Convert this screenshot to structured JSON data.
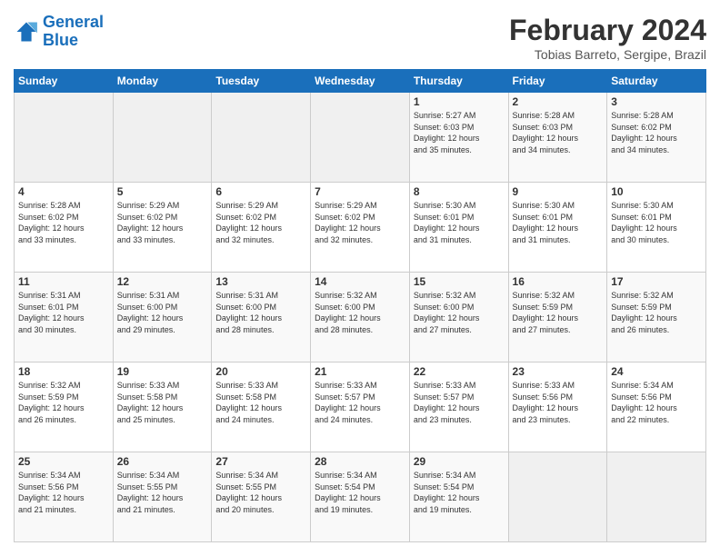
{
  "header": {
    "logo_text_general": "General",
    "logo_text_blue": "Blue",
    "month_title": "February 2024",
    "location": "Tobias Barreto, Sergipe, Brazil"
  },
  "weekdays": [
    "Sunday",
    "Monday",
    "Tuesday",
    "Wednesday",
    "Thursday",
    "Friday",
    "Saturday"
  ],
  "weeks": [
    [
      {
        "day": "",
        "info": ""
      },
      {
        "day": "",
        "info": ""
      },
      {
        "day": "",
        "info": ""
      },
      {
        "day": "",
        "info": ""
      },
      {
        "day": "1",
        "info": "Sunrise: 5:27 AM\nSunset: 6:03 PM\nDaylight: 12 hours\nand 35 minutes."
      },
      {
        "day": "2",
        "info": "Sunrise: 5:28 AM\nSunset: 6:03 PM\nDaylight: 12 hours\nand 34 minutes."
      },
      {
        "day": "3",
        "info": "Sunrise: 5:28 AM\nSunset: 6:02 PM\nDaylight: 12 hours\nand 34 minutes."
      }
    ],
    [
      {
        "day": "4",
        "info": "Sunrise: 5:28 AM\nSunset: 6:02 PM\nDaylight: 12 hours\nand 33 minutes."
      },
      {
        "day": "5",
        "info": "Sunrise: 5:29 AM\nSunset: 6:02 PM\nDaylight: 12 hours\nand 33 minutes."
      },
      {
        "day": "6",
        "info": "Sunrise: 5:29 AM\nSunset: 6:02 PM\nDaylight: 12 hours\nand 32 minutes."
      },
      {
        "day": "7",
        "info": "Sunrise: 5:29 AM\nSunset: 6:02 PM\nDaylight: 12 hours\nand 32 minutes."
      },
      {
        "day": "8",
        "info": "Sunrise: 5:30 AM\nSunset: 6:01 PM\nDaylight: 12 hours\nand 31 minutes."
      },
      {
        "day": "9",
        "info": "Sunrise: 5:30 AM\nSunset: 6:01 PM\nDaylight: 12 hours\nand 31 minutes."
      },
      {
        "day": "10",
        "info": "Sunrise: 5:30 AM\nSunset: 6:01 PM\nDaylight: 12 hours\nand 30 minutes."
      }
    ],
    [
      {
        "day": "11",
        "info": "Sunrise: 5:31 AM\nSunset: 6:01 PM\nDaylight: 12 hours\nand 30 minutes."
      },
      {
        "day": "12",
        "info": "Sunrise: 5:31 AM\nSunset: 6:00 PM\nDaylight: 12 hours\nand 29 minutes."
      },
      {
        "day": "13",
        "info": "Sunrise: 5:31 AM\nSunset: 6:00 PM\nDaylight: 12 hours\nand 28 minutes."
      },
      {
        "day": "14",
        "info": "Sunrise: 5:32 AM\nSunset: 6:00 PM\nDaylight: 12 hours\nand 28 minutes."
      },
      {
        "day": "15",
        "info": "Sunrise: 5:32 AM\nSunset: 6:00 PM\nDaylight: 12 hours\nand 27 minutes."
      },
      {
        "day": "16",
        "info": "Sunrise: 5:32 AM\nSunset: 5:59 PM\nDaylight: 12 hours\nand 27 minutes."
      },
      {
        "day": "17",
        "info": "Sunrise: 5:32 AM\nSunset: 5:59 PM\nDaylight: 12 hours\nand 26 minutes."
      }
    ],
    [
      {
        "day": "18",
        "info": "Sunrise: 5:32 AM\nSunset: 5:59 PM\nDaylight: 12 hours\nand 26 minutes."
      },
      {
        "day": "19",
        "info": "Sunrise: 5:33 AM\nSunset: 5:58 PM\nDaylight: 12 hours\nand 25 minutes."
      },
      {
        "day": "20",
        "info": "Sunrise: 5:33 AM\nSunset: 5:58 PM\nDaylight: 12 hours\nand 24 minutes."
      },
      {
        "day": "21",
        "info": "Sunrise: 5:33 AM\nSunset: 5:57 PM\nDaylight: 12 hours\nand 24 minutes."
      },
      {
        "day": "22",
        "info": "Sunrise: 5:33 AM\nSunset: 5:57 PM\nDaylight: 12 hours\nand 23 minutes."
      },
      {
        "day": "23",
        "info": "Sunrise: 5:33 AM\nSunset: 5:56 PM\nDaylight: 12 hours\nand 23 minutes."
      },
      {
        "day": "24",
        "info": "Sunrise: 5:34 AM\nSunset: 5:56 PM\nDaylight: 12 hours\nand 22 minutes."
      }
    ],
    [
      {
        "day": "25",
        "info": "Sunrise: 5:34 AM\nSunset: 5:56 PM\nDaylight: 12 hours\nand 21 minutes."
      },
      {
        "day": "26",
        "info": "Sunrise: 5:34 AM\nSunset: 5:55 PM\nDaylight: 12 hours\nand 21 minutes."
      },
      {
        "day": "27",
        "info": "Sunrise: 5:34 AM\nSunset: 5:55 PM\nDaylight: 12 hours\nand 20 minutes."
      },
      {
        "day": "28",
        "info": "Sunrise: 5:34 AM\nSunset: 5:54 PM\nDaylight: 12 hours\nand 19 minutes."
      },
      {
        "day": "29",
        "info": "Sunrise: 5:34 AM\nSunset: 5:54 PM\nDaylight: 12 hours\nand 19 minutes."
      },
      {
        "day": "",
        "info": ""
      },
      {
        "day": "",
        "info": ""
      }
    ]
  ]
}
